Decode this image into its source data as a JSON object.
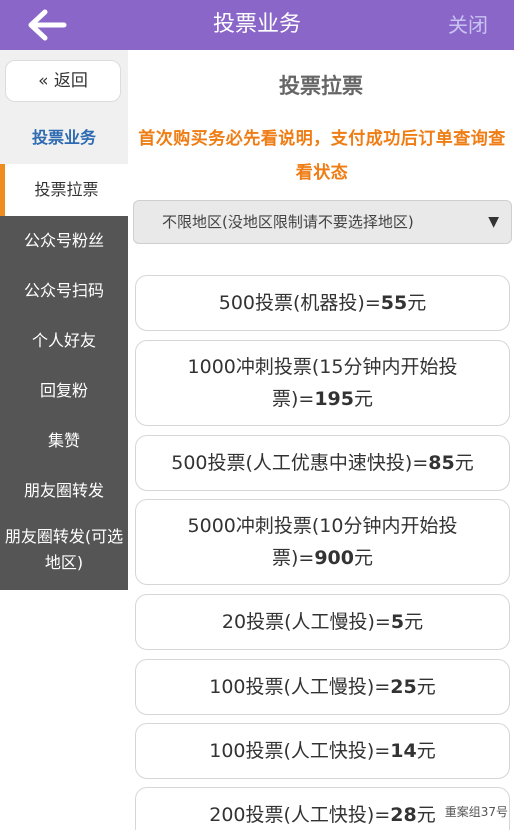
{
  "header": {
    "title": "投票业务",
    "close_label": "关闭",
    "accent_color": "#8a66c9"
  },
  "sidebar": {
    "back_label": "« 返回",
    "category_label": "投票业务",
    "items": [
      {
        "label": "投票拉票",
        "active": true
      },
      {
        "label": "公众号粉丝"
      },
      {
        "label": "公众号扫码"
      },
      {
        "label": "个人好友"
      },
      {
        "label": "回复粉"
      },
      {
        "label": "集赞"
      },
      {
        "label": "朋友圈转发"
      },
      {
        "label": "朋友圈转发(可选地区)"
      }
    ]
  },
  "main": {
    "title": "投票拉票",
    "notice": "首次购买务必先看说明，支付成功后订单查询查看状态",
    "notice_color": "#ef7d14",
    "region_select": {
      "value": "不限地区(没地区限制请不要选择地区)",
      "arrow": "▼"
    },
    "options": [
      {
        "line1": "500投票(机器投)=",
        "price": "55",
        "unit": "元"
      },
      {
        "line1": "1000冲刺投票(15分钟内开始投",
        "line2": "票)=",
        "price": "195",
        "unit": "元"
      },
      {
        "line1": "500投票(人工优惠中速快投)=",
        "price": "85",
        "unit": "元"
      },
      {
        "line1": "5000冲刺投票(10分钟内开始投",
        "line2": "票)=",
        "price": "900",
        "unit": "元"
      },
      {
        "line1": "20投票(人工慢投)=",
        "price": "5",
        "unit": "元"
      },
      {
        "line1": "100投票(人工慢投)=",
        "price": "25",
        "unit": "元"
      },
      {
        "line1": "100投票(人工快投)=",
        "price": "14",
        "unit": "元"
      },
      {
        "line1": "200投票(人工快投)=",
        "price": "28",
        "unit": "元"
      }
    ]
  },
  "watermark": "重案组37号"
}
